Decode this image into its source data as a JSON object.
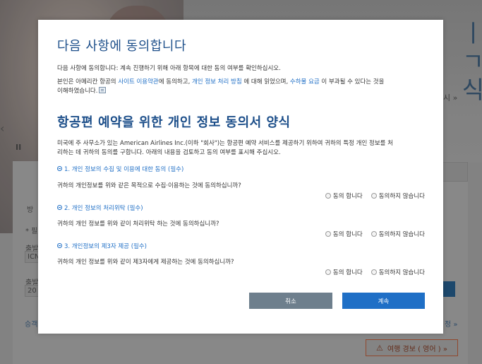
{
  "background": {
    "headline": "ㅑ\nㄱ\n식",
    "more_link": "시 »",
    "panel": {
      "row1_label": "방",
      "row2_label": "* 필",
      "depart_label": "출발",
      "depart_value": "ICN",
      "date_label": "출발",
      "date_value": "20",
      "bottom_link": "승객",
      "right_link": "정 »"
    },
    "travel_button": "여행 경보 ( 영어 ) »"
  },
  "modal": {
    "title": "다음 사항에 동의합니다",
    "intro": "다음 사항에 동의합니다: 계속 진행하기 위해 아래 항목에 대한 동의 여부를 확인하십시오.",
    "consent_text_1": "본인은 아메리칸 항공의 ",
    "terms_link": "사이트 이용약관",
    "consent_text_2": "에 동의하고, ",
    "privacy_link": "개인 정보 처리 방침",
    "consent_text_3": " 에 대해 읽었으며, ",
    "fee_link": "수하물 요금",
    "consent_text_4": " 이 부과될 수 있다는 것을",
    "consent_text_5": "이해하였습니다.",
    "form_title": "항공편 예약을 위한 개인 정보 동의서 양식",
    "form_intro_1": "미국에 주 사무소가 있는 American Airlines Inc.(이하 \"회사\")는 항공편 예약 서비스를 제공하기 위하여 귀하의 특정 개인 정보를 처",
    "form_intro_2": "리하는 데 귀하의 동의를 구합니다. 아래의 내용을 검토하고 동의 여부를 표시해 주십시오.",
    "sections": [
      {
        "heading": "1. 개인 정보의 수집 및 이용에 대한 동의 (필수)",
        "question": "귀하의 개인정보를 위와 같은 목적으로 수집·이용하는 것에 동의하십니까?",
        "agree": "동의 합니다",
        "disagree": "동의하지 않습니다"
      },
      {
        "heading": "2. 개인 정보의 처리위탁 (필수)",
        "question": "귀하의 개인 정보를 위와 같이 처리위탁 하는 것에 동의하십니까?",
        "agree": "동의 합니다",
        "disagree": "동의하지 않습니다"
      },
      {
        "heading": "3. 개인정보의 제3자 제공 (필수)",
        "question": "귀하의 개인 정보를 위와 같이 제3자에게 제공하는 것에 동의하십니까?",
        "agree": "동의 합니다",
        "disagree": "동의하지 않습니다"
      }
    ],
    "cancel_label": "취소",
    "continue_label": "계속",
    "colors": {
      "title": "#1d4f8a",
      "link": "#1f6fc6",
      "cancel": "#6e7f8d",
      "continue": "#1f6fc6"
    }
  }
}
